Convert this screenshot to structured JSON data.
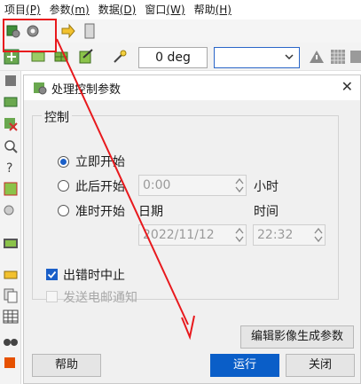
{
  "menubar": {
    "items": [
      {
        "label": "项目",
        "key": "(P)"
      },
      {
        "label": "参数",
        "key": "(m)"
      },
      {
        "label": "数据",
        "key": "(D)"
      },
      {
        "label": "窗口",
        "key": "(W)"
      },
      {
        "label": "帮助",
        "key": "(H)"
      }
    ]
  },
  "toolbar": {
    "rotation_value": "0 deg",
    "combo_value": ""
  },
  "dialog": {
    "title": "处理控制参数",
    "close_glyph": "✕",
    "group_title": "控制",
    "start_now_label": "立即开始",
    "start_after_label": "此后开始",
    "start_after_value": "0:00",
    "hours_label": "小时",
    "start_at_label": "准时开始",
    "date_label": "日期",
    "time_label": "时间",
    "date_value": "2022/11/12",
    "time_value": "22:32",
    "stop_on_error_label": "出错时中止",
    "send_email_label": "发送电邮通知",
    "edit_image_params_button": "编辑影像生成参数",
    "help_button": "帮助",
    "run_button": "运行",
    "close_button": "关闭"
  },
  "colors": {
    "accent": "#0a5ec8",
    "annotation": "#e8191d"
  }
}
